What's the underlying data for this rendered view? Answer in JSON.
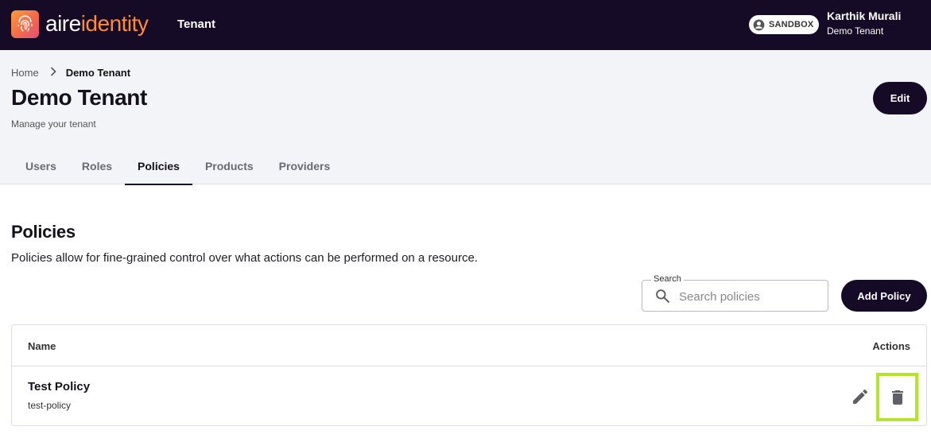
{
  "topnav": {
    "brand_part1": "aire",
    "brand_part2": "identity",
    "section": "Tenant",
    "environment": "SANDBOX",
    "user_name": "Karthik Murali",
    "user_tenant": "Demo Tenant",
    "logo_icon": "fingerprint-icon",
    "env_icon": "account-circle-icon"
  },
  "breadcrumb": {
    "home": "Home",
    "current": "Demo Tenant",
    "separator_icon": "chevron-right-icon"
  },
  "page": {
    "title": "Demo Tenant",
    "subtitle": "Manage your tenant",
    "edit_label": "Edit"
  },
  "tabs": [
    {
      "label": "Users",
      "active": false
    },
    {
      "label": "Roles",
      "active": false
    },
    {
      "label": "Policies",
      "active": true
    },
    {
      "label": "Products",
      "active": false
    },
    {
      "label": "Providers",
      "active": false
    }
  ],
  "policies": {
    "title": "Policies",
    "description": "Policies allow for fine-grained control over what actions can be performed on a resource.",
    "search_label": "Search",
    "search_placeholder": "Search policies",
    "search_value": "",
    "add_label": "Add Policy",
    "columns": {
      "name": "Name",
      "actions": "Actions"
    },
    "rows": [
      {
        "name": "Test Policy",
        "id": "test-policy",
        "edit_icon": "pencil-icon",
        "delete_icon": "trash-icon"
      }
    ]
  },
  "colors": {
    "nav_bg": "#150b26",
    "accent": "#ff8a3d",
    "highlight": "#b6e32e"
  }
}
